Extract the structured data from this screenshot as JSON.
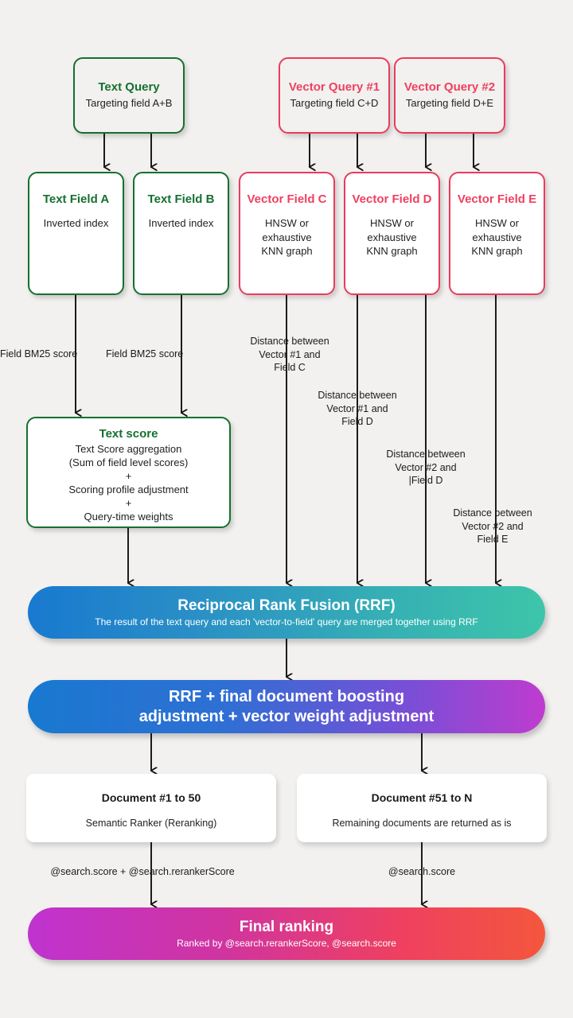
{
  "diagram": {
    "title": "Hybrid search scoring and ranking flow",
    "background_color": "#f2f1ef",
    "colors": {
      "text_accent": "#15702f",
      "vector_accent": "#ef4060",
      "rrf_gradient_from": "#1879d0",
      "rrf_gradient_to": "#3cc3ac",
      "boost_gradient_from": "#1879d0",
      "boost_gradient_to": "#b93cd2",
      "final_gradient_from": "#bf33cf",
      "final_gradient_to": "#f4543f"
    }
  },
  "queries": [
    {
      "title": "Text Query",
      "sub": "Targeting field A+B",
      "accent": "green"
    },
    {
      "title": "Vector Query #1",
      "sub": "Targeting field C+D",
      "accent": "pink"
    },
    {
      "title": "Vector Query #2",
      "sub": "Targeting field D+E",
      "accent": "pink"
    }
  ],
  "fields": [
    {
      "title": "Text Field A",
      "sub": "Inverted index",
      "accent": "green"
    },
    {
      "title": "Text Field B",
      "sub": "Inverted index",
      "accent": "green"
    },
    {
      "title": "Vector Field C",
      "sub": "HNSW or\nexhaustive\nKNN graph",
      "accent": "pink"
    },
    {
      "title": "Vector Field D",
      "sub": "HNSW or\nexhaustive\nKNN graph",
      "accent": "pink"
    },
    {
      "title": "Vector Field E",
      "sub": "HNSW or\nexhaustive\nKNN graph",
      "accent": "pink"
    }
  ],
  "edge_labels": {
    "bm25_a": "Field BM25 score",
    "bm25_b": "Field BM25 score",
    "dist_c": "Distance between\nVector #1 and\nField C",
    "dist_d1": "Distance between\nVector #1 and\nField D",
    "dist_d2": "Distance between\nVector #2 and\n|Field D",
    "dist_e": "Distance between\nVector #2 and\nField E",
    "reranked_score": "@search.score + @search.rerankerScore",
    "plain_score": "@search.score"
  },
  "text_score": {
    "title": "Text score",
    "lines": [
      "Text Score aggregation",
      "(Sum of field level scores)",
      "+",
      "Scoring profile adjustment",
      "+",
      "Query-time weights"
    ]
  },
  "rrf": {
    "title": "Reciprocal Rank Fusion (RRF)",
    "sub": "The result of the text query and each 'vector-to-field' query are merged together using RRF"
  },
  "boost": {
    "title_line1": "RRF + final document boosting",
    "title_line2": "adjustment + vector weight adjustment"
  },
  "documents": [
    {
      "title": "Document #1 to 50",
      "sub": "Semantic Ranker (Reranking)"
    },
    {
      "title": "Document #51 to N",
      "sub": "Remaining documents are returned as is"
    }
  ],
  "final": {
    "title": "Final ranking",
    "sub": "Ranked by @search.rerankerScore, @search.score"
  }
}
